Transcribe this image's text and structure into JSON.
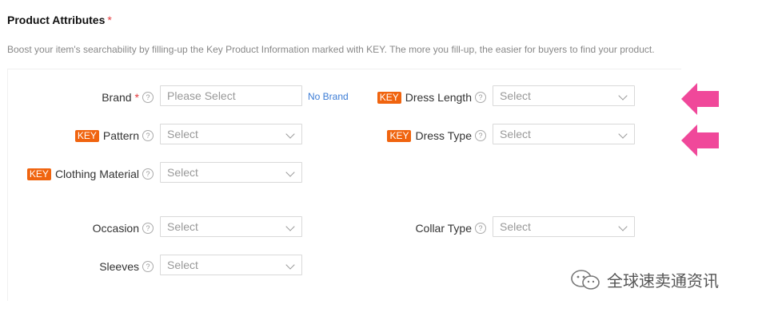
{
  "section": {
    "title": "Product Attributes",
    "required_mark": "*",
    "hint": "Boost your item's searchability by filling-up the Key Product Information marked with KEY. The more you fill-up, the easier for buyers to find your product."
  },
  "key_badge": "KEY",
  "help_icon": "?",
  "fields": {
    "brand": {
      "label": "Brand",
      "required": "*",
      "placeholder": "Please Select",
      "no_brand": "No Brand"
    },
    "dress_length": {
      "label": "Dress Length",
      "value": "Select"
    },
    "pattern": {
      "label": "Pattern",
      "value": "Select"
    },
    "dress_type": {
      "label": "Dress Type",
      "value": "Select"
    },
    "clothing_material": {
      "label": "Clothing Material",
      "value": "Select"
    },
    "occasion": {
      "label": "Occasion",
      "value": "Select"
    },
    "collar_type": {
      "label": "Collar Type",
      "value": "Select"
    },
    "sleeves": {
      "label": "Sleeves",
      "value": "Select"
    }
  },
  "watermark": {
    "text": "全球速卖通资讯"
  },
  "colors": {
    "key_badge": "#f0640f",
    "arrow": "#f0489a",
    "required": "#e4393c",
    "link": "#3a7bd5"
  }
}
